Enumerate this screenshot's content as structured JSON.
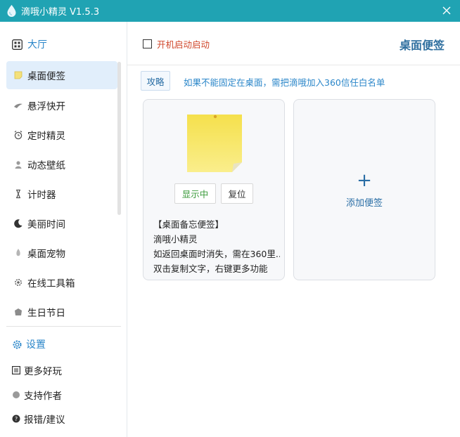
{
  "window": {
    "title": "滴哦小精灵 V1.5.3"
  },
  "sidebar": {
    "hall_label": "大厅",
    "items": [
      {
        "label": "桌面便签",
        "icon": "sticky-note-icon",
        "active": true
      },
      {
        "label": "悬浮快开",
        "icon": "float-launch-icon"
      },
      {
        "label": "定时精灵",
        "icon": "alarm-clock-icon"
      },
      {
        "label": "动态壁纸",
        "icon": "wallpaper-icon"
      },
      {
        "label": "计时器",
        "icon": "hourglass-icon"
      },
      {
        "label": "美丽时间",
        "icon": "moon-icon"
      },
      {
        "label": "桌面宠物",
        "icon": "pet-icon"
      },
      {
        "label": "在线工具箱",
        "icon": "toolbox-gear-icon"
      },
      {
        "label": "生日节日",
        "icon": "gift-icon"
      }
    ],
    "settings_label": "设置",
    "footer": [
      {
        "label": "更多好玩",
        "icon": "list-icon"
      },
      {
        "label": "支持作者",
        "icon": "dot-icon"
      },
      {
        "label": "报错/建议",
        "icon": "help-icon"
      }
    ]
  },
  "main": {
    "autostart_label": "开机启动启动",
    "page_title": "桌面便签",
    "guide_label": "攻略",
    "hint": "如果不能固定在桌面，需把滴哦加入360信任白名单",
    "note_card": {
      "show_label": "显示中",
      "reset_label": "复位",
      "lines": [
        "【桌面备忘便签】",
        "滴哦小精灵",
        "如返回桌面时消失，需在360里...",
        "双击复制文字，右键更多功能"
      ]
    },
    "add_card": {
      "plus": "+",
      "label": "添加便签"
    }
  },
  "colors": {
    "titlebar": "#20a3b3",
    "accent": "#2a86c9",
    "active_item_bg": "#e1eefb",
    "warning_text": "#d0482c",
    "show_green": "#3a9a3a",
    "note_yellow": "#f6e35a"
  }
}
